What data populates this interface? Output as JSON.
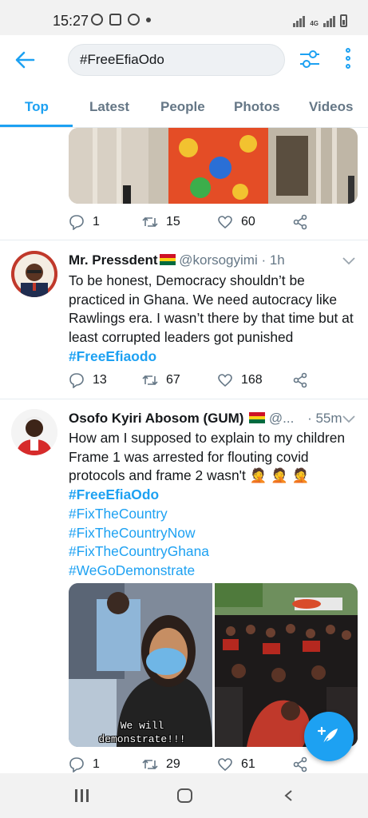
{
  "status_bar": {
    "time": "15:27",
    "network": "4G"
  },
  "header": {
    "search_value": "#FreeEfiaOdo"
  },
  "tabs": [
    {
      "label": "Top",
      "active": true
    },
    {
      "label": "Latest",
      "active": false
    },
    {
      "label": "People",
      "active": false
    },
    {
      "label": "Photos",
      "active": false
    },
    {
      "label": "Videos",
      "active": false
    }
  ],
  "tweets": [
    {
      "replies": "1",
      "retweets": "15",
      "likes": "60"
    },
    {
      "name": "Mr. Pressdent",
      "handle": "@korsogyimi",
      "time": "· 1h",
      "text": "To be honest, Democracy shouldn’t be practiced in Ghana. We need autocracy like Rawlings era. I wasn’t there by that time but at least corrupted leaders got punished",
      "hashtags": [
        "#FreeEfiaodo"
      ],
      "replies": "13",
      "retweets": "67",
      "likes": "168"
    },
    {
      "name": "Osofo Kyiri Abosom (GUM)",
      "handle": "@...",
      "time": "· 55m",
      "text": "How am I supposed to explain to my children Frame 1 was arrested for flouting covid protocols and frame 2 wasn't",
      "emoji": "🤦 🤦 🤦",
      "hashtags": [
        "#FreeEfiaOdo",
        "#FixTheCountry",
        "#FixTheCountryNow",
        "#FixTheCountryGhana",
        "#WeGoDemonstrate"
      ],
      "image_caption": "We will demonstrate!!!",
      "replies": "1",
      "retweets": "29",
      "likes": "61"
    }
  ],
  "colors": {
    "accent": "#1da1f2",
    "text": "#14171a",
    "muted": "#657786",
    "divider": "#e6ecf0"
  },
  "icons": {
    "back": "arrow-left-icon",
    "filter": "sliders-icon",
    "more": "vertical-dots-icon",
    "reply": "speech-bubble-icon",
    "retweet": "retweet-icon",
    "like": "heart-icon",
    "share": "share-icon",
    "compose": "feather-plus-icon"
  }
}
